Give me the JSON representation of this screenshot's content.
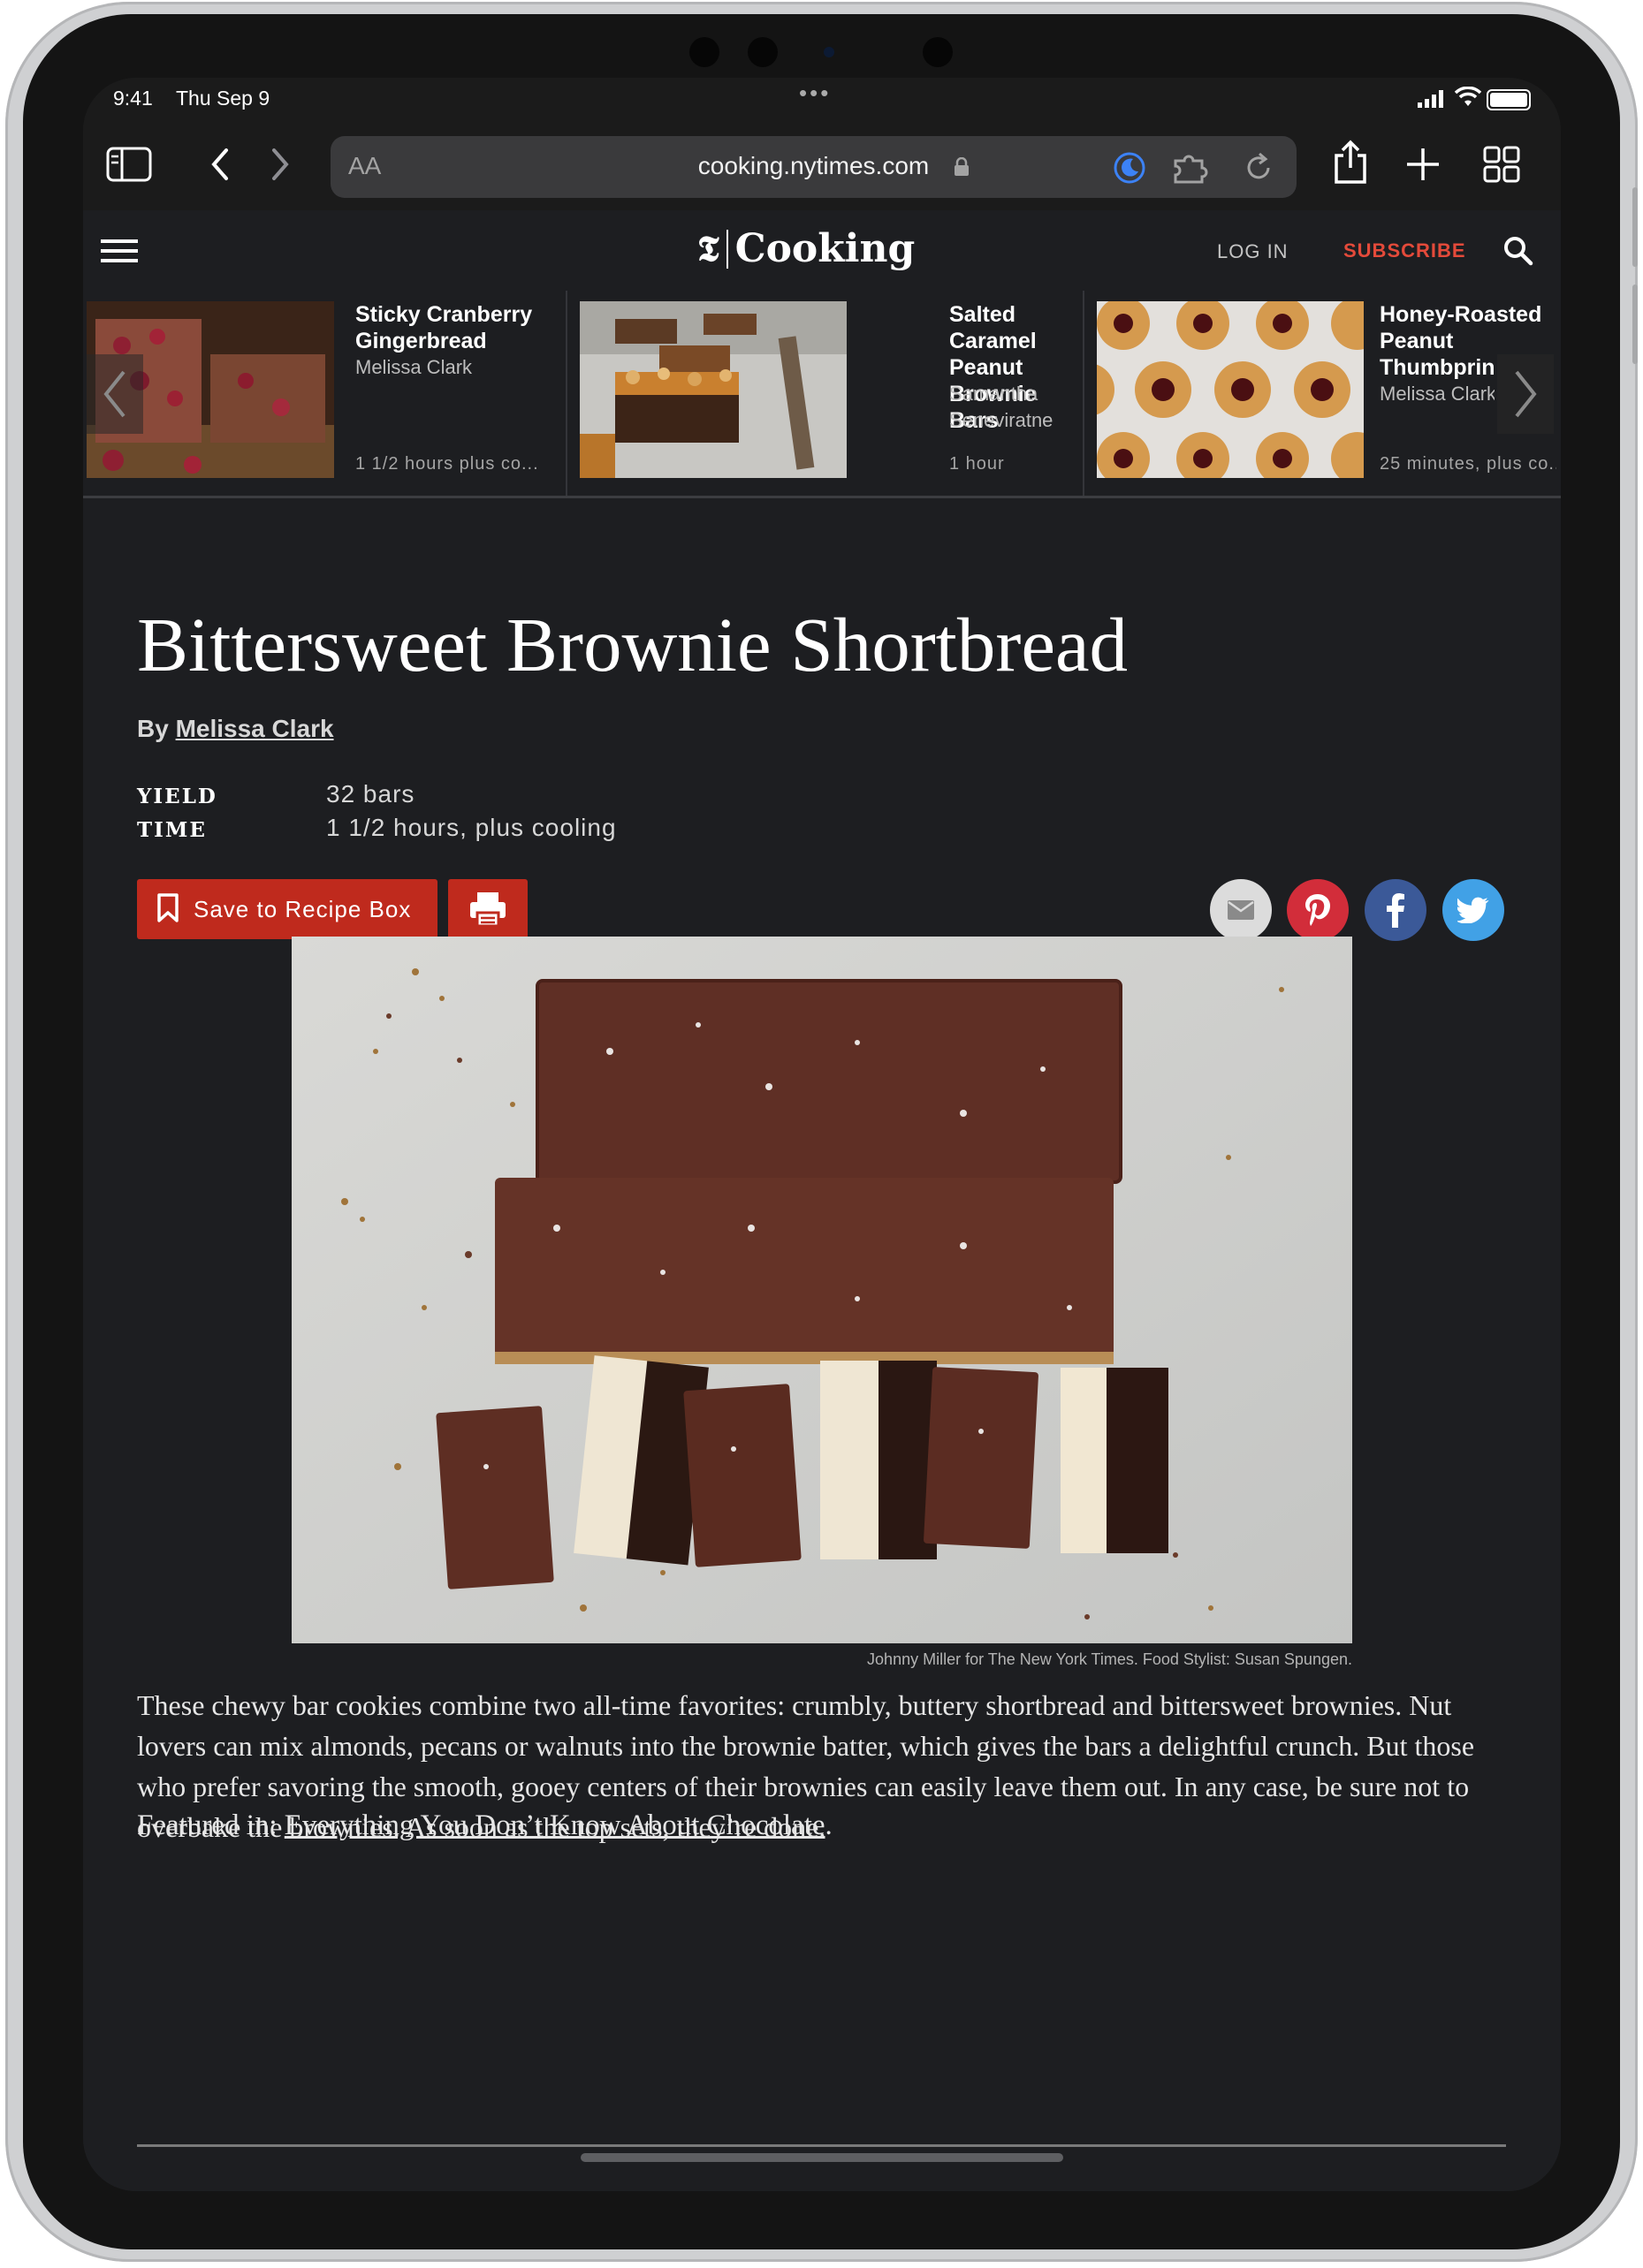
{
  "status_bar": {
    "time": "9:41",
    "date": "Thu Sep 9",
    "multitask_dots": "•••"
  },
  "browser": {
    "text_size_label": "AA",
    "url": "cooking.nytimes.com",
    "accent_color": "#3c82f6"
  },
  "site_header": {
    "logo_mark": "𝕿",
    "logo_text": "Cooking",
    "login_label": "LOG IN",
    "subscribe_label": "SUBSCRIBE",
    "subscribe_color": "#e44a3a"
  },
  "carousel": {
    "items": [
      {
        "title_line1": "Sticky Cranberry",
        "title_line2": "Gingerbread",
        "title_line3": "",
        "author_line1": "Melissa Clark",
        "author_line2": "",
        "duration": "1 1/2 hours plus co..."
      },
      {
        "title_line1": "Salted Caramel",
        "title_line2": "Peanut Brownie",
        "title_line3": "Bars",
        "author_line1": "Samantha",
        "author_line2": "Seneviratne",
        "duration": "1 hour"
      },
      {
        "title_line1": "Honey-Roasted",
        "title_line2": "Peanut",
        "title_line3": "Thumbprin",
        "author_line1": "Melissa Clark",
        "author_line2": "",
        "duration": "25 minutes, plus co..."
      }
    ]
  },
  "recipe": {
    "title": "Bittersweet Brownie Shortbread",
    "by_prefix": "By",
    "author": "Melissa Clark",
    "yield_label": "YIELD",
    "yield_value": "32 bars",
    "time_label": "TIME",
    "time_value": "1 1/2 hours, plus cooling",
    "save_label": "Save to Recipe Box",
    "photo_credit": "Johnny Miller for The New York Times. Food Stylist: Susan Spungen.",
    "description": "These chewy bar cookies combine two all-time favorites: crumbly, buttery shortbread and bittersweet brownies. Nut lovers can mix almonds, pecans or walnuts into the brownie batter, which gives the bars a delightful crunch. But those who prefer savoring the smooth, gooey centers of their brownies can easily leave them out. In any case, be sure not to overbake the brownies. As soon as the top sets, they’re done.",
    "featured_prefix": "Featured in: ",
    "featured_link": "Everything You Don’t Know About Chocolate",
    "featured_suffix": "."
  },
  "share_colors": {
    "email": "#dcdcdc",
    "pinterest": "#d22d3a",
    "facebook": "#3b5998",
    "twitter": "#41a1e6"
  },
  "save_button_color": "#bf2a1d"
}
